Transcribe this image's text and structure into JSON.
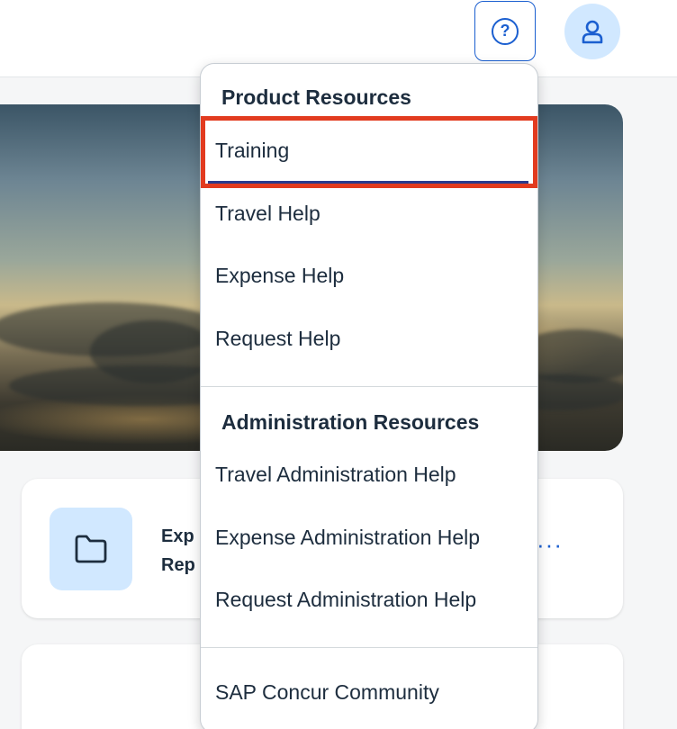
{
  "header": {
    "help_glyph": "?",
    "help_icon": "help-circle-icon",
    "avatar_icon": "user-icon"
  },
  "card": {
    "title": "Expense Reports",
    "title_visible": "Exp Rep",
    "menu_glyph": "···"
  },
  "help_menu": {
    "product_header": "Product Resources",
    "product_items": [
      "Training",
      "Travel Help",
      "Expense Help",
      "Request Help"
    ],
    "admin_header": "Administration Resources",
    "admin_items": [
      "Travel Administration Help",
      "Expense Administration Help",
      "Request Administration Help"
    ],
    "community": "SAP Concur Community"
  },
  "colors": {
    "accent": "#1b5fd0",
    "highlight": "#e23b1f",
    "avatar_bg": "#d1e8ff",
    "text": "#1d2d3e"
  }
}
